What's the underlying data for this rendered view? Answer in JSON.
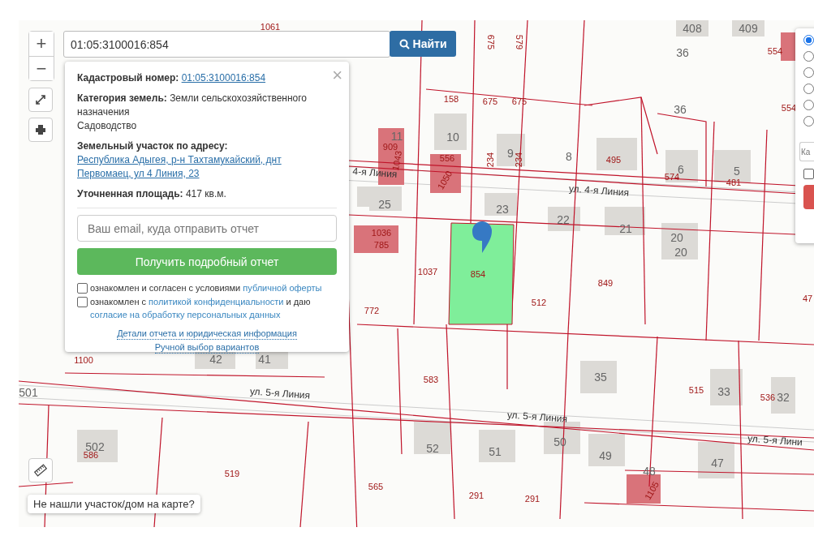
{
  "search": {
    "value": "01:05:3100016:854",
    "button": "Найти"
  },
  "zoom": {
    "in": "+",
    "out": "−"
  },
  "popup": {
    "close": "×",
    "fields": [
      {
        "label": "Кадастровый номер:",
        "value": "01:05:3100016:854",
        "link": true
      },
      {
        "label": "Категория земель:",
        "value": "Земли сельскохозяйственного назначения",
        "extra": "Садоводство",
        "link": false
      },
      {
        "label": "Земельный участок по адресу:",
        "value": "Республика Адыгея, р-н Тахтамукайский, днт Первомаец, ул 4 Линия, 23",
        "link": true
      },
      {
        "label": "Уточненная площадь:",
        "value": "417 кв.м.",
        "link": false
      }
    ],
    "email_placeholder": "Ваш email, куда отправить отчет",
    "submit": "Получить подробный отчет",
    "consents": [
      {
        "checked": false,
        "parts": [
          {
            "text": "ознакомлен и согласен с условиями ",
            "link": false
          },
          {
            "text": "публичной оферты",
            "link": true
          }
        ]
      },
      {
        "checked": false,
        "parts": [
          {
            "text": "ознакомлен с ",
            "link": false
          },
          {
            "text": "политикой конфиденциальности",
            "link": true
          },
          {
            "text": " и даю ",
            "link": false
          },
          {
            "text": "согласие на обработку персональных данных",
            "link": true
          }
        ]
      }
    ],
    "links": [
      "Детали отчета и юридическая информация",
      "Ручной выбор вариантов"
    ]
  },
  "map": {
    "labels": [
      "1061",
      "408",
      "409",
      "675",
      "579",
      "36",
      "554",
      "36",
      "554",
      "158",
      "675",
      "675",
      "11",
      "909",
      "1043",
      "10",
      "556",
      "1050",
      "234",
      "9",
      "234",
      "8",
      "495",
      "6",
      "574",
      "5",
      "481",
      "25",
      "23",
      "22",
      "21",
      "20",
      "20",
      "1036",
      "785",
      "1037",
      "854",
      "512",
      "849",
      "772",
      "47",
      "1100",
      "42",
      "41",
      "583",
      "35",
      "515",
      "33",
      "536",
      "32",
      "501",
      "52",
      "51",
      "50",
      "49",
      "48",
      "1105",
      "47",
      "502",
      "586",
      "519",
      "565",
      "291",
      "291"
    ],
    "streets": [
      "4-я Линия",
      "ул. 4-я Линия",
      "ул. 5-я Линия",
      "ул. 5-я Линия",
      "ул. 5-я Лини"
    ]
  },
  "hint": "Не нашли участок/дом на карте?",
  "layer_panel": {
    "options": [
      {
        "selected": true
      },
      {
        "selected": false
      },
      {
        "selected": false
      },
      {
        "selected": false
      },
      {
        "selected": false
      },
      {
        "selected": false
      }
    ],
    "field_placeholder": "Ка",
    "checkbox": {
      "checked": false
    }
  }
}
